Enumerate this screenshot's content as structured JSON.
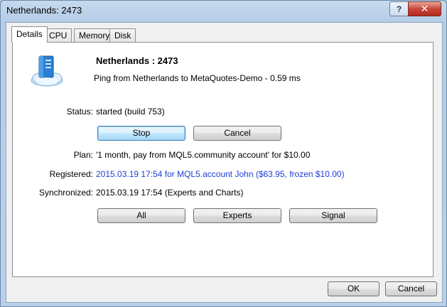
{
  "window": {
    "title": "Netherlands: 2473",
    "help_label": "?",
    "close_label": "✕"
  },
  "tabs": [
    {
      "label": "Details"
    },
    {
      "label": "CPU"
    },
    {
      "label": "Memory"
    },
    {
      "label": "Disk"
    }
  ],
  "details": {
    "icon": "cloud-server-icon",
    "heading": "Netherlands : 2473",
    "ping": "Ping from Netherlands to MetaQuotes-Demo - 0.59 ms",
    "status_label": "Status:",
    "status_value": "started (build 753)",
    "stop_label": "Stop",
    "cancel_label": "Cancel",
    "plan_label": "Plan:",
    "plan_value": "'1 month, pay from MQL5.community account' for $10.00",
    "registered_label": "Registered:",
    "registered_value": "2015.03.19 17:54 for MQL5.account John ($63.95, frozen $10.00)",
    "synchronized_label": "Synchronized:",
    "synchronized_value": "2015.03.19 17:54 (Experts and Charts)",
    "all_label": "All",
    "experts_label": "Experts",
    "signal_label": "Signal"
  },
  "footer": {
    "ok_label": "OK",
    "cancel_label": "Cancel"
  },
  "colors": {
    "link": "#1e3ed6",
    "title_close": "#c7483a"
  }
}
